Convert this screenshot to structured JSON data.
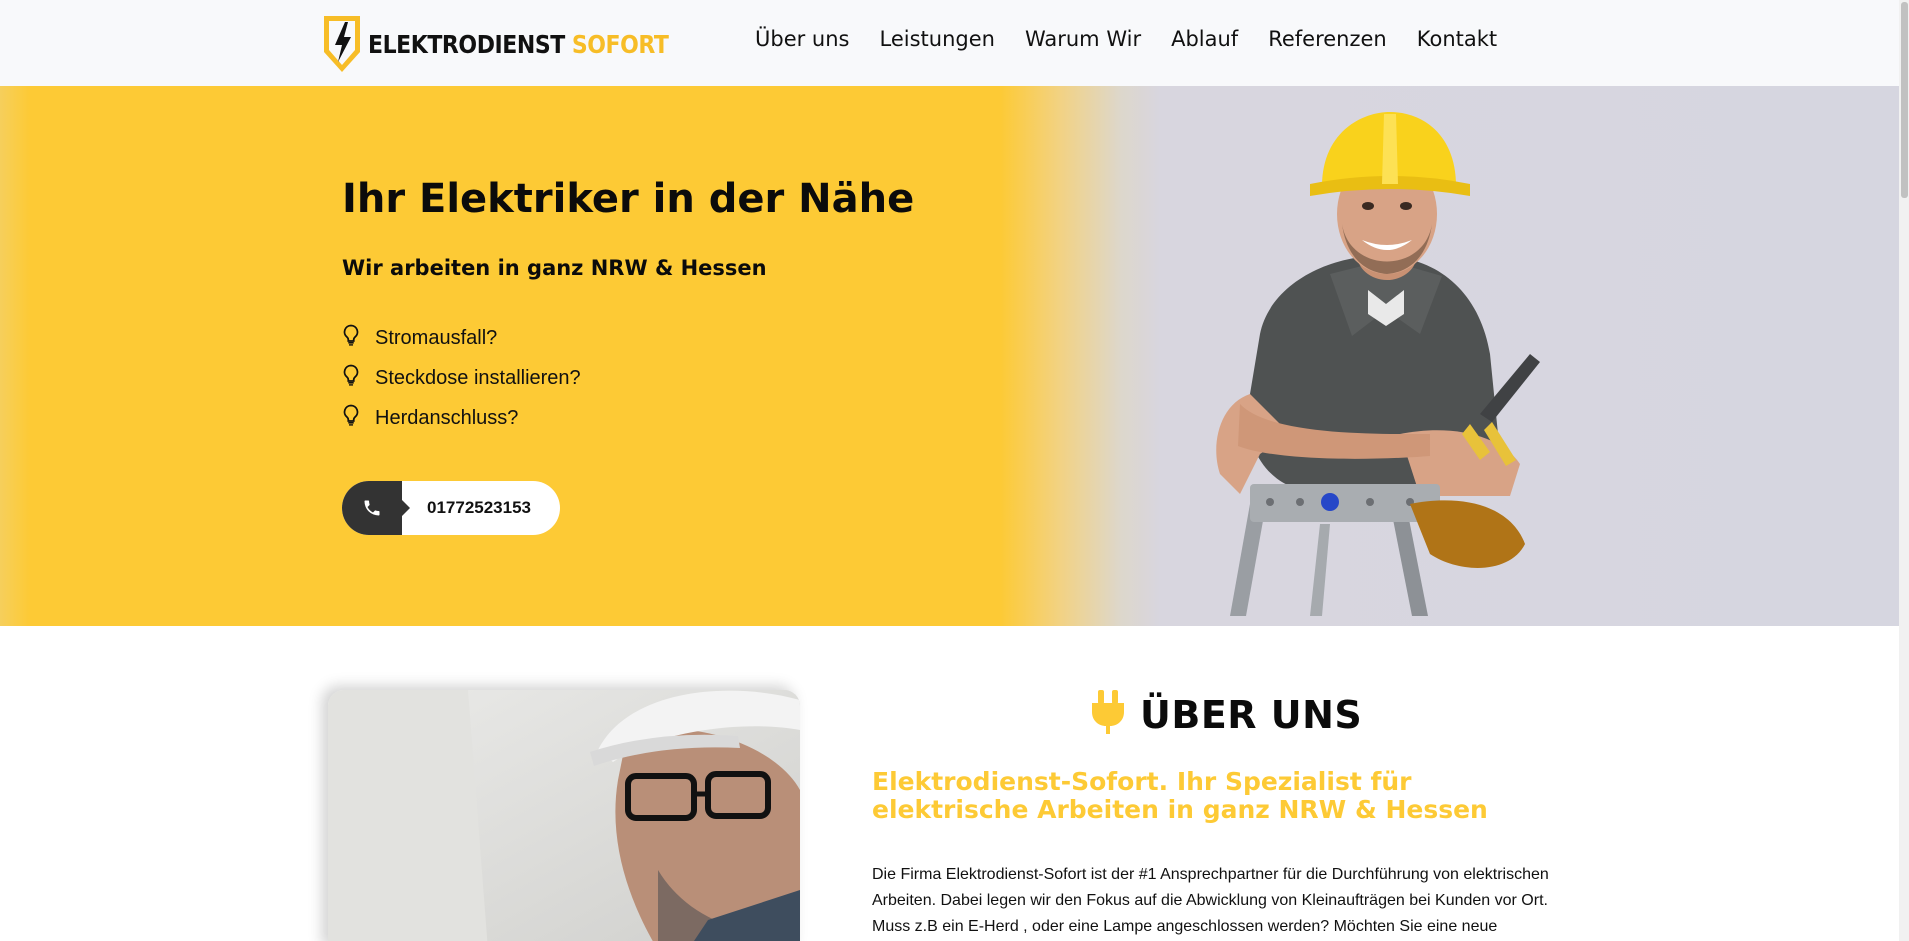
{
  "colors": {
    "accent": "#fdca35",
    "dark": "#333333",
    "header_bg": "#f8f9fb"
  },
  "header": {
    "logo": {
      "word1": "ELEKTRODIENST",
      "word2": "SOFORT",
      "icon": "lightning-shield-icon"
    },
    "nav": [
      "Über uns",
      "Leistungen",
      "Warum Wir",
      "Ablauf",
      "Referenzen",
      "Kontakt"
    ]
  },
  "hero": {
    "title": "Ihr Elektriker in der Nähe",
    "subtitle": "Wir arbeiten in ganz NRW & Hessen",
    "list_icon": "lightbulb-icon",
    "items": [
      "Stromausfall?",
      "Steckdose installieren?",
      "Herdanschluss?"
    ],
    "phone": {
      "icon": "phone-icon",
      "number": "01772523153"
    }
  },
  "about": {
    "icon": "plug-icon",
    "title": "ÜBER UNS",
    "subtitle": "Elektrodienst-Sofort. Ihr Spezialist für elektrische Arbeiten in ganz NRW & Hessen",
    "text": "Die Firma Elektrodienst-Sofort ist der #1 Ansprechpartner für die Durchführung von elektrischen Arbeiten. Dabei legen wir den Fokus auf die Abwicklung von Kleinaufträgen bei Kunden vor Ort. Muss z.B ein E-Herd , oder eine Lampe angeschlossen werden? Möchten Sie eine neue"
  }
}
